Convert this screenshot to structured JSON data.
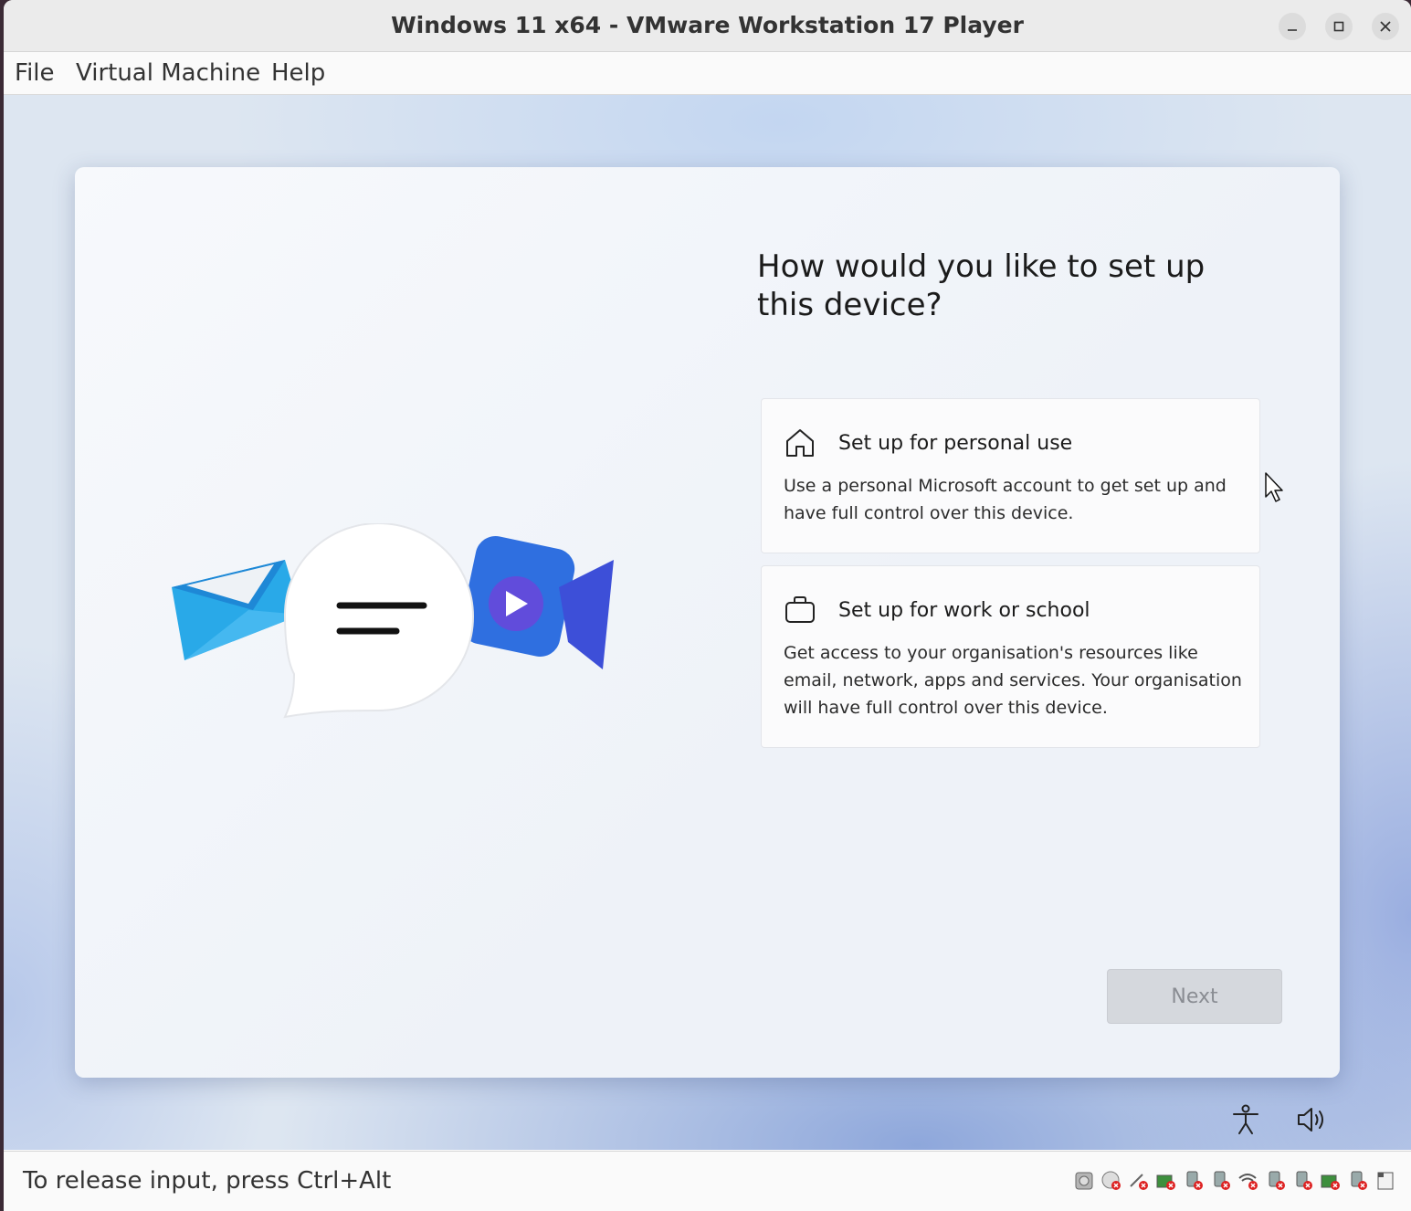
{
  "window": {
    "title": "Windows 11 x64 - VMware Workstation 17 Player",
    "controls": [
      "minimize-icon",
      "maximize-icon",
      "close-icon"
    ]
  },
  "menubar": {
    "items": [
      "File",
      "Virtual Machine",
      "Help"
    ]
  },
  "oobe": {
    "heading": "How would you like to set up this device?",
    "options": [
      {
        "icon": "home-icon",
        "title": "Set up for personal use",
        "description": "Use a personal Microsoft account to get set up and have full control over this device."
      },
      {
        "icon": "briefcase-icon",
        "title": "Set up for work or school",
        "description": "Get access to your organisation's resources like email, network, apps and services. Your organisation will have full control over this device."
      }
    ],
    "next_label": "Next",
    "bottom_icons": [
      "accessibility-icon",
      "volume-icon"
    ]
  },
  "statusbar": {
    "text": "To release input, press Ctrl+Alt",
    "device_icons": [
      "hard-disk-icon",
      "cd-dvd-icon",
      "floppy-icon",
      "network-adapter-icon",
      "usb-icon",
      "usb-icon",
      "wifi-icon",
      "usb-icon",
      "usb-icon",
      "network-icon",
      "usb-icon",
      "message-icon"
    ]
  },
  "colors": {
    "accent_blue": "#0f6cbd",
    "next_disabled_bg": "#d5d8dd",
    "next_disabled_text": "#8a8d93"
  }
}
